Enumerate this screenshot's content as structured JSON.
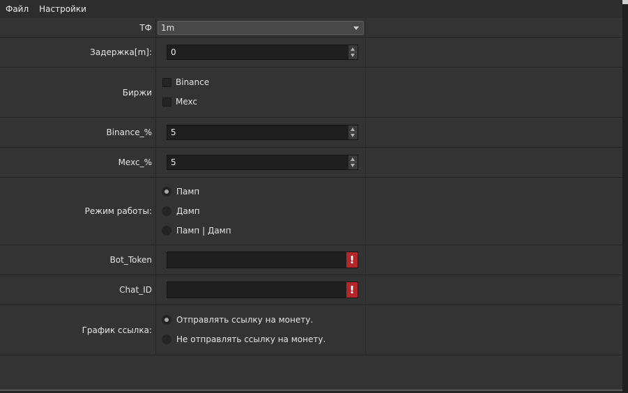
{
  "menu": {
    "items": [
      "Файл",
      "Настройки"
    ]
  },
  "form": {
    "tf": {
      "label": "ТФ",
      "value": "1m"
    },
    "delay": {
      "label": "Задержка[m]:",
      "value": "0"
    },
    "exchanges": {
      "label": "Биржи",
      "options": [
        "Binance",
        "Mexc"
      ]
    },
    "binance_pct": {
      "label": "Binance_%",
      "value": "5"
    },
    "mexc_pct": {
      "label": "Mexc_%",
      "value": "5"
    },
    "mode": {
      "label": "Режим работы:",
      "options": [
        "Памп",
        "Дамп",
        "Памп | Дамп"
      ],
      "selected": "Памп"
    },
    "bot_token": {
      "label": "Bot_Token",
      "value": ""
    },
    "chat_id": {
      "label": "Chat_ID",
      "value": ""
    },
    "chart_link": {
      "label": "График ссылка:",
      "options": [
        "Отправлять ссылку на монету.",
        "Не отправлять ссылку на монету."
      ],
      "selected": "Отправлять ссылку на монету."
    }
  },
  "colors": {
    "background": "#333333",
    "input": "#1f1f1f",
    "error": "#b3262a"
  },
  "icons": {
    "combo_arrow": "chevron-down-icon",
    "spin": "spin-arrows-icon",
    "error": "exclamation-icon"
  }
}
